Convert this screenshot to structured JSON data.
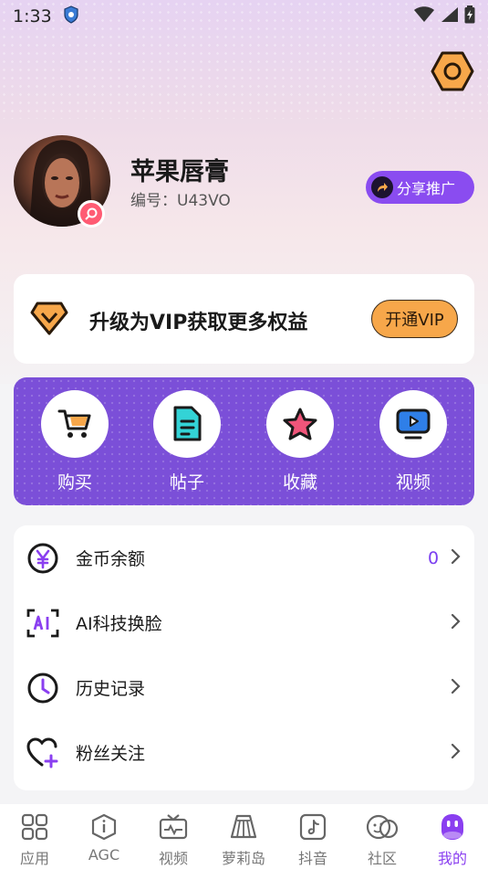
{
  "status": {
    "time": "1:33"
  },
  "profile": {
    "username": "苹果唇膏",
    "user_id": "编号：U43VO",
    "share_label": "分享推广"
  },
  "vip": {
    "text": "升级为VIP获取更多权益",
    "button": "开通VIP"
  },
  "quick_actions": [
    {
      "label": "购买",
      "icon": "cart-icon"
    },
    {
      "label": "帖子",
      "icon": "document-icon"
    },
    {
      "label": "收藏",
      "icon": "star-icon"
    },
    {
      "label": "视频",
      "icon": "video-play-icon"
    }
  ],
  "menu": [
    {
      "label": "金币余额",
      "value": "0",
      "icon": "yen-coin-icon"
    },
    {
      "label": "AI科技换脸",
      "value": "",
      "icon": "ai-face-icon"
    },
    {
      "label": "历史记录",
      "value": "",
      "icon": "clock-icon"
    },
    {
      "label": "粉丝关注",
      "value": "",
      "icon": "heart-plus-icon"
    }
  ],
  "tabs": [
    {
      "label": "应用",
      "icon": "grid-icon"
    },
    {
      "label": "AGC",
      "icon": "info-hex-icon"
    },
    {
      "label": "视频",
      "icon": "tv-icon"
    },
    {
      "label": "萝莉岛",
      "icon": "skirt-icon"
    },
    {
      "label": "抖音",
      "icon": "tiktok-icon"
    },
    {
      "label": "社区",
      "icon": "community-icon"
    },
    {
      "label": "我的",
      "icon": "profile-icon",
      "active": true
    }
  ],
  "colors": {
    "accent": "#7b4fd8",
    "share": "#8a4cf0",
    "vip_button": "#f7a74a",
    "settings": "#f7a74a",
    "active_tab": "#8a3ff0"
  }
}
